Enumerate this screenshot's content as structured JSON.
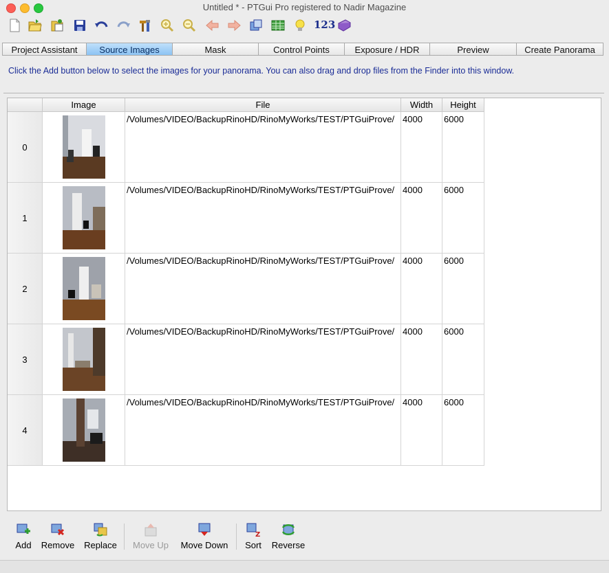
{
  "window": {
    "title": "Untitled * - PTGui Pro registered to Nadir Magazine"
  },
  "toolbar": {
    "icons": [
      "new-icon",
      "open-icon",
      "open-recent-icon",
      "save-icon",
      "undo-icon",
      "redo-icon",
      "tools-icon",
      "zoom-in-icon",
      "zoom-out-icon",
      "back-icon",
      "forward-icon",
      "panorama-editor-icon",
      "table-icon",
      "tip-icon",
      "numbers-icon",
      "help-book-icon"
    ],
    "numbers_label": "123"
  },
  "tabs": [
    {
      "label": "Project Assistant",
      "active": false
    },
    {
      "label": "Source Images",
      "active": true
    },
    {
      "label": "Mask",
      "active": false
    },
    {
      "label": "Control Points",
      "active": false
    },
    {
      "label": "Exposure / HDR",
      "active": false
    },
    {
      "label": "Preview",
      "active": false
    },
    {
      "label": "Create Panorama",
      "active": false
    }
  ],
  "hint": "Click the Add button below to select the images for your panorama. You can also drag and drop files from the Finder into this window.",
  "table": {
    "headers": {
      "index": "",
      "image": "Image",
      "file": "File",
      "width": "Width",
      "height": "Height"
    },
    "rows": [
      {
        "index": "0",
        "file": "/Volumes/VIDEO/BackupRinoHD/RinoMyWorks/TEST/PTGuiProve/",
        "width": "4000",
        "height": "6000"
      },
      {
        "index": "1",
        "file": "/Volumes/VIDEO/BackupRinoHD/RinoMyWorks/TEST/PTGuiProve/",
        "width": "4000",
        "height": "6000"
      },
      {
        "index": "2",
        "file": "/Volumes/VIDEO/BackupRinoHD/RinoMyWorks/TEST/PTGuiProve/",
        "width": "4000",
        "height": "6000"
      },
      {
        "index": "3",
        "file": "/Volumes/VIDEO/BackupRinoHD/RinoMyWorks/TEST/PTGuiProve/",
        "width": "4000",
        "height": "6000"
      },
      {
        "index": "4",
        "file": "/Volumes/VIDEO/BackupRinoHD/RinoMyWorks/TEST/PTGuiProve/",
        "width": "4000",
        "height": "6000"
      }
    ]
  },
  "buttons": {
    "add": "Add",
    "remove": "Remove",
    "replace": "Replace",
    "move_up": "Move Up",
    "move_down": "Move Down",
    "sort": "Sort",
    "reverse": "Reverse"
  }
}
